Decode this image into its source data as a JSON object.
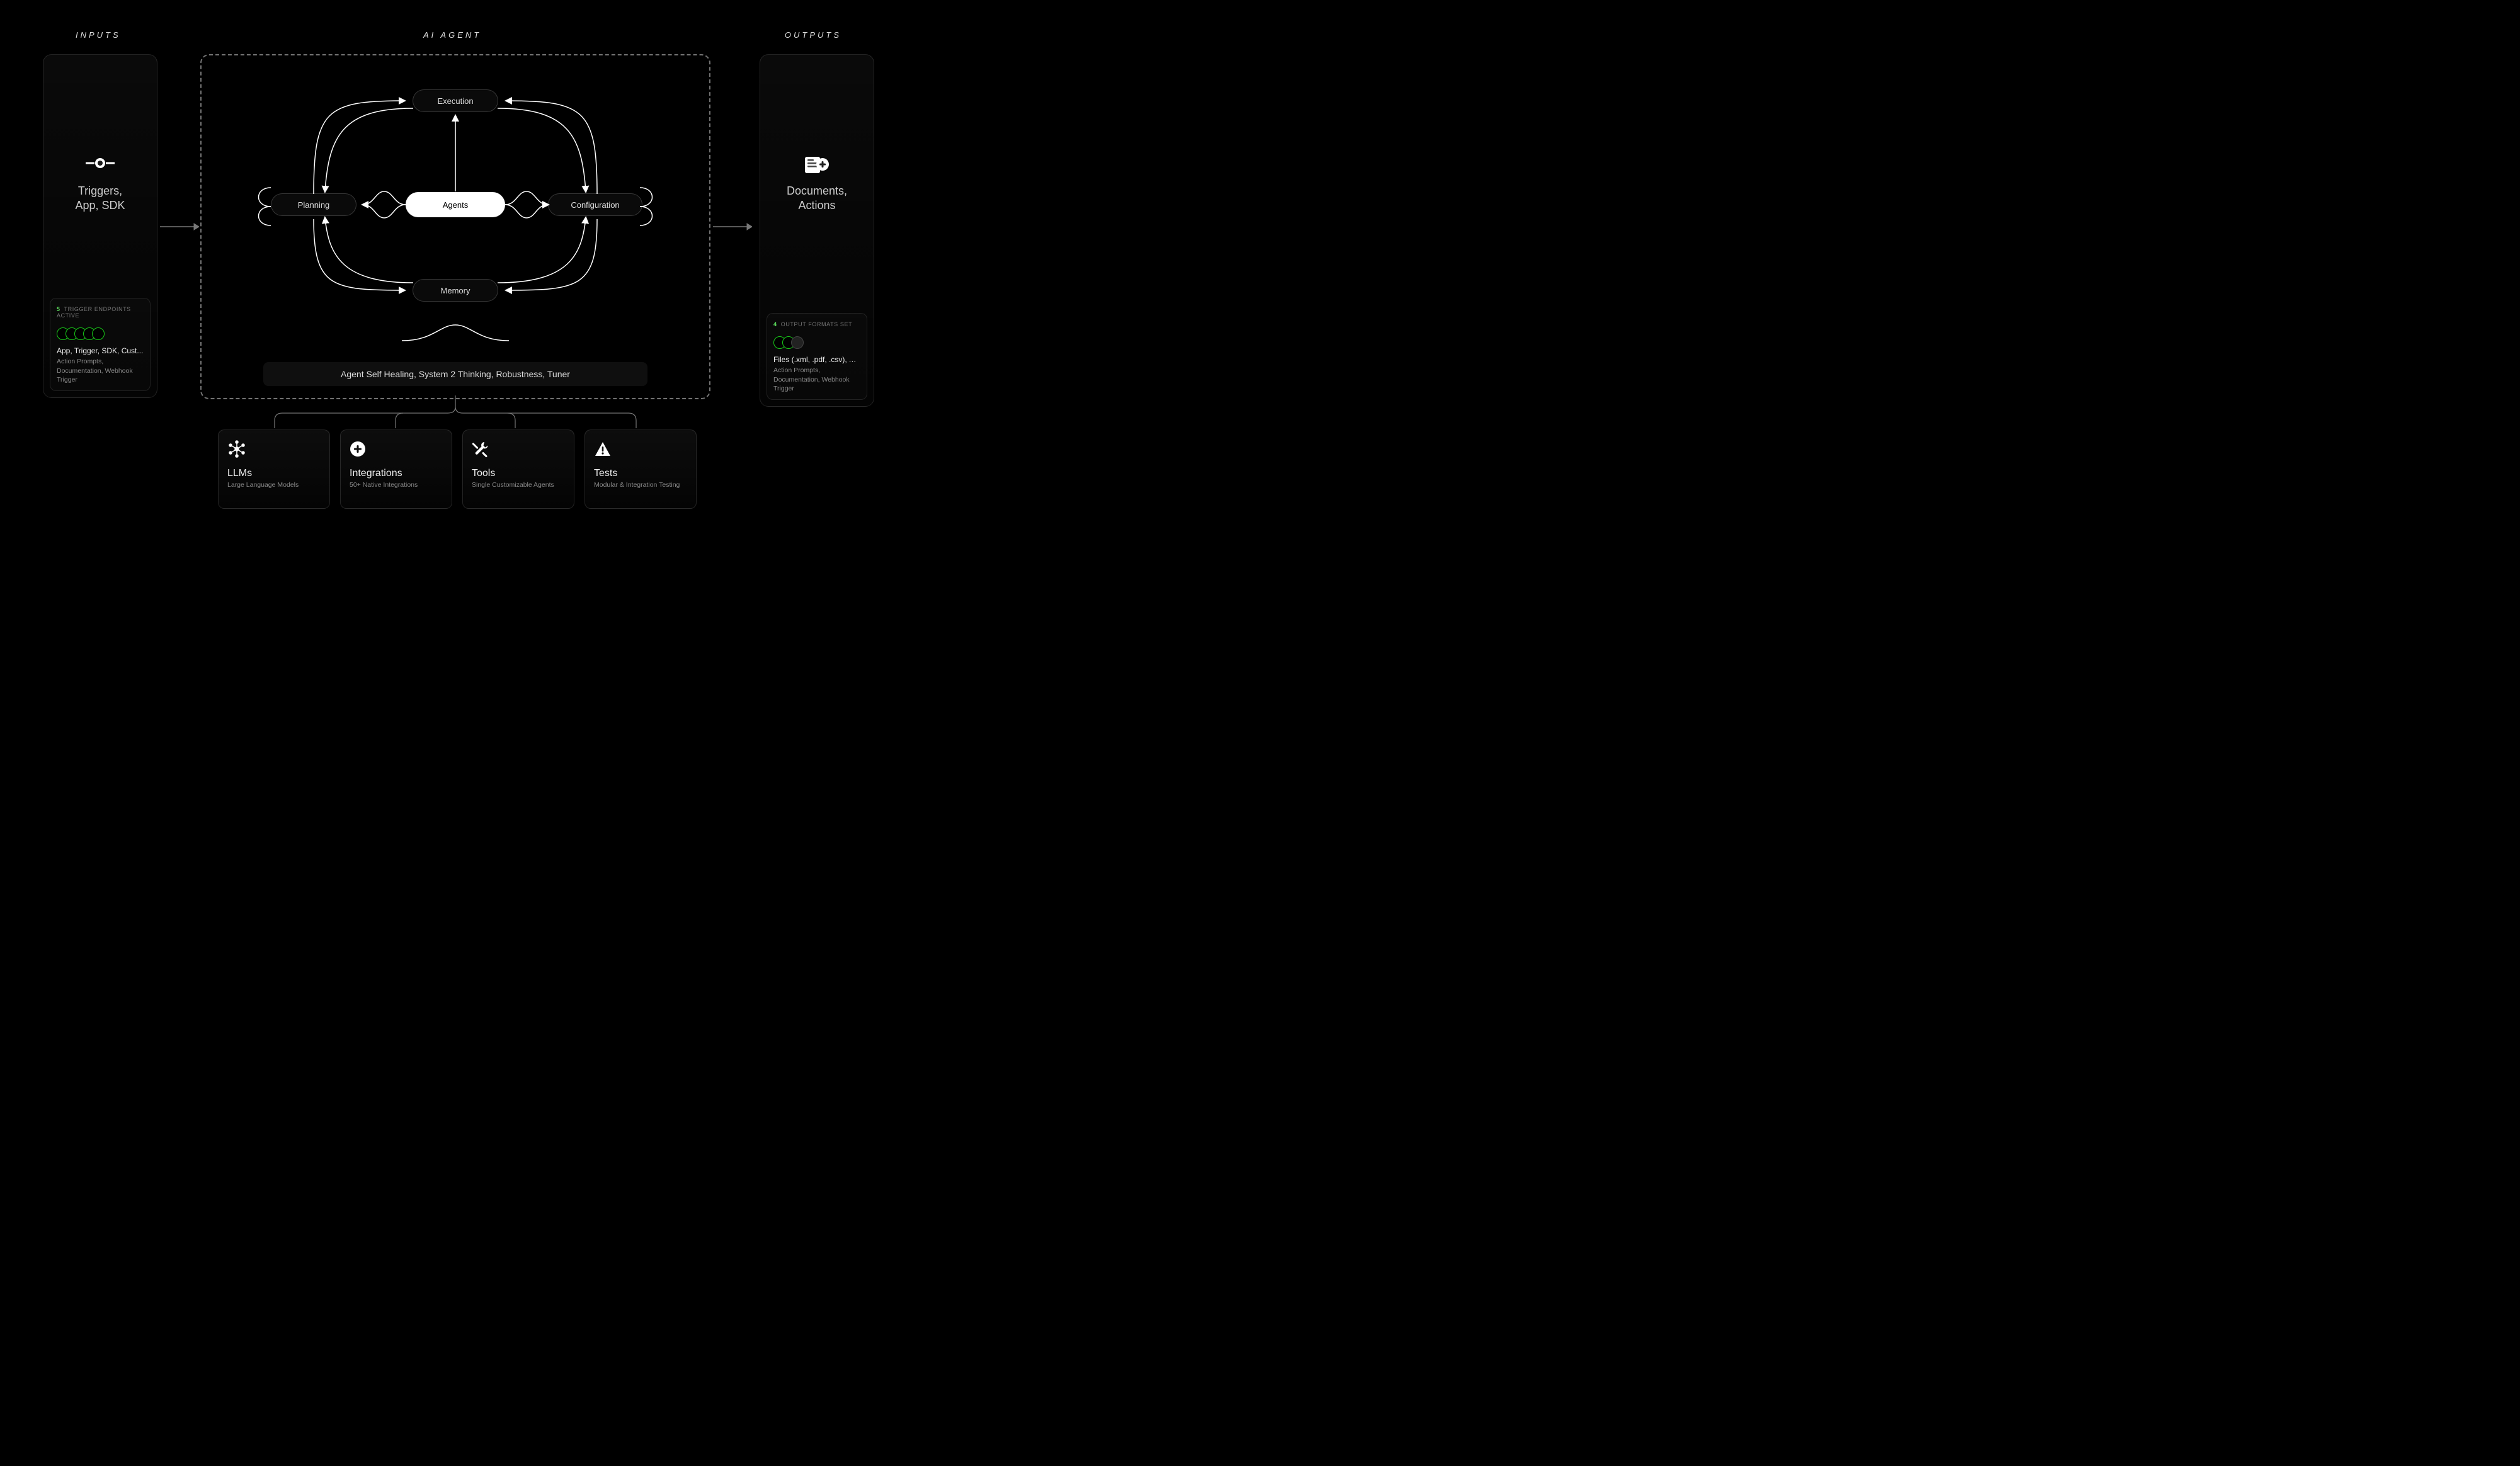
{
  "headings": {
    "inputs": "INPUTS",
    "agent": "AI AGENT",
    "outputs": "OUTPUTS"
  },
  "inputs": {
    "title": "Triggers,\nApp, SDK",
    "status": {
      "count": "5",
      "label": "TRIGGER ENDPOINTS ACTIVE",
      "dots": 5,
      "main": "App, Trigger, SDK, Cust...",
      "sub": "Action Prompts, Documentation, Webhook Trigger"
    }
  },
  "outputs": {
    "title": "Documents,\nActions",
    "status": {
      "count": "4",
      "label": "OUTPUT FORMATS SET",
      "dots": 2,
      "extra_dots": 1,
      "main": "Files (.xml, .pdf, .csv), Ac...",
      "sub": "Action Prompts, Documentation, Webhook Trigger"
    }
  },
  "agent": {
    "nodes": {
      "execution": "Execution",
      "planning": "Planning",
      "agents": "Agents",
      "configuration": "Configuration",
      "memory": "Memory"
    },
    "features": "Agent Self Healing, System 2 Thinking, Robustness, Tuner"
  },
  "subcards": [
    {
      "title": "LLMs",
      "sub": "Large Language Models",
      "icon": "network"
    },
    {
      "title": "Integrations",
      "sub": "50+ Native Integrations",
      "icon": "plus"
    },
    {
      "title": "Tools",
      "sub": "Single Customizable Agents",
      "icon": "tools"
    },
    {
      "title": "Tests",
      "sub": "Modular & Integration Testing",
      "icon": "warning"
    }
  ]
}
